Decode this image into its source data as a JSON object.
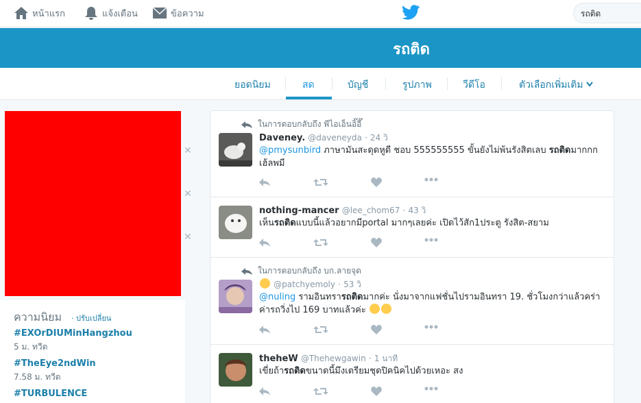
{
  "nav": {
    "home_label": "หน้าแรก",
    "notifications_label": "แจ้งเตือน",
    "messages_label": "ข้อความ",
    "search_value": "รถติด"
  },
  "banner": {
    "title": "รถติด"
  },
  "tabs": [
    {
      "label": "ยอดนิยม"
    },
    {
      "label": "สด",
      "active": true
    },
    {
      "label": "บัญชี"
    },
    {
      "label": "รูปภาพ"
    },
    {
      "label": "วีดีโอ"
    },
    {
      "label": "ตัวเลือกเพิ่มเติม"
    }
  ],
  "trends": {
    "title": "ความนิยม",
    "change_label": "· ปรับเปลี่ยน",
    "items": [
      {
        "name": "#EXOrDIUMinHangzhou",
        "count": "5 ม. ทวีต"
      },
      {
        "name": "#TheEye2ndWin",
        "count": "7.58 ม. ทวีต"
      },
      {
        "name": "#TURBULENCE",
        "count": ""
      }
    ]
  },
  "tweets": [
    {
      "reply_context": "ในการตอบกลับถึง พีไอเอ็นอิ๊อี๊",
      "name": "Daveney.",
      "handle": "@daveneyda",
      "time": "24 วิ",
      "mention": "@pmysunbird",
      "text_before": " ภาษามันสะดุดหูดี ชอบ 555555555 ขั้นยังไม่พ้นรังสิตเลบ ",
      "highlight": "รถติด",
      "text_after": "มากกกเฮ้ลพมี"
    },
    {
      "reply_context": "",
      "name": "nothing-mancer",
      "handle": "@lee_chom67",
      "time": "43 วิ",
      "mention": "",
      "text_before": "เห็น",
      "highlight": "รถติด",
      "text_after": "แบบนี้แล้วอยากมีportal มากๆเลยค่ะ เปิดไว้สัก1ประตู รังสิต-สยาม"
    },
    {
      "reply_context": "ในการตอบกลับถึง บก.ลายจุด",
      "name": "",
      "handle": "@patchyemoly",
      "time": "53 วิ",
      "mention": "@nuling",
      "text_before": " รามอินทรา",
      "highlight": "รถติด",
      "text_after": "มากค่ะ นั่งมาจากแฟชั่นไปรามอินทรา 19. ชั่วโมงกว่าแล้วคร่าค่ารถวิ่งไป 169 บาทแล้วค่ะ"
    },
    {
      "reply_context": "",
      "name": "theheW",
      "handle": "@Thehewgawin",
      "time": "1 นาที",
      "mention": "",
      "text_before": "เขี่ยถ้า",
      "highlight": "รถติด",
      "text_after": "ขนาดนี้มึงเตรียมชุดปิคนิคไปด้วยเหอะ สง"
    }
  ],
  "colors": {
    "banner": "#1b95c6",
    "link": "#1b95e0",
    "ad_block": "#ff0000"
  }
}
